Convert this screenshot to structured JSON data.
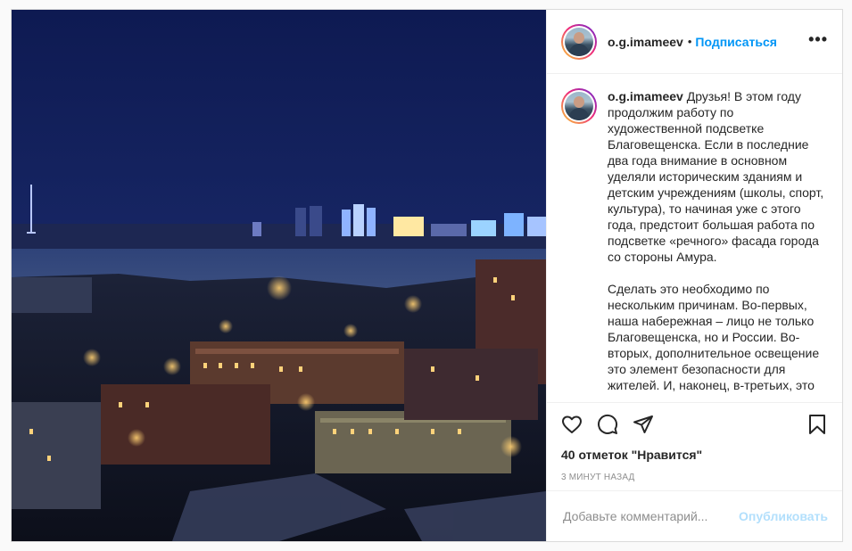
{
  "post": {
    "author": "o.g.imameev",
    "separator": "•",
    "follow_label": "Подписаться",
    "more_label": "•••",
    "caption_text": "Друзья! В этом году продолжим работу по художественной подсветке Благовещенска. Если в последние два года внимание в основном уделяли историческим зданиям и детским учреждениям (школы, спорт, культура), то начиная уже с этого года, предстоит большая работа по подсветке «речного» фасада города со стороны Амура.\n\nСделать это необходимо по нескольким причинам. Во-первых, наша набережная – лицо не только Благовещенска, но и России. Во-вторых, дополнительное освещение это элемент безопасности для жителей. И, наконец, в-третьих, это",
    "likes_text": "40 отметок \"Нравится\"",
    "timestamp": "3 МИНУТ НАЗАД"
  },
  "comment_box": {
    "placeholder": "Добавьте комментарий...",
    "publish_label": "Опубликовать"
  },
  "icons": {
    "like": "heart-icon",
    "comment": "comment-bubble-icon",
    "share": "paper-plane-icon",
    "save": "bookmark-icon",
    "more": "more-dots-icon"
  },
  "colors": {
    "link": "#0095f6",
    "publish_disabled": "#b2dffc",
    "muted": "#8e8e8e",
    "sky": "#0d1b4d"
  }
}
